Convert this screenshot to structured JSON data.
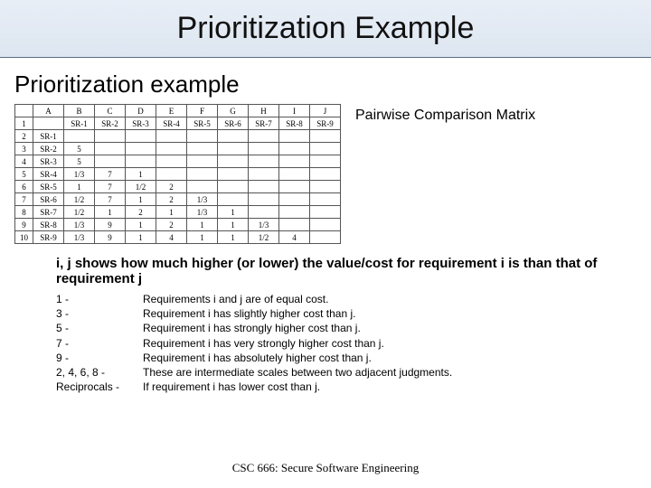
{
  "title": "Prioritization Example",
  "subtitle": "Prioritization example",
  "matrix_caption": "Pairwise Comparison Matrix",
  "columns": [
    "",
    "A",
    "B",
    "C",
    "D",
    "E",
    "F",
    "G",
    "H",
    "I",
    "J"
  ],
  "header_row": [
    "1",
    "",
    "SR-1",
    "SR-2",
    "SR-3",
    "SR-4",
    "SR-5",
    "SR-6",
    "SR-7",
    "SR-8",
    "SR-9"
  ],
  "rows": [
    [
      "2",
      "SR-1",
      "",
      "",
      "",
      "",
      "",
      "",
      "",
      "",
      ""
    ],
    [
      "3",
      "SR-2",
      "5",
      "",
      "",
      "",
      "",
      "",
      "",
      "",
      ""
    ],
    [
      "4",
      "SR-3",
      "5",
      "",
      "",
      "",
      "",
      "",
      "",
      "",
      ""
    ],
    [
      "5",
      "SR-4",
      "1/3",
      "7",
      "1",
      "",
      "",
      "",
      "",
      "",
      ""
    ],
    [
      "6",
      "SR-5",
      "1",
      "7",
      "1/2",
      "2",
      "",
      "",
      "",
      "",
      ""
    ],
    [
      "7",
      "SR-6",
      "1/2",
      "7",
      "1",
      "2",
      "1/3",
      "",
      "",
      "",
      ""
    ],
    [
      "8",
      "SR-7",
      "1/2",
      "1",
      "2",
      "1",
      "1/3",
      "1",
      "",
      "",
      ""
    ],
    [
      "9",
      "SR-8",
      "1/3",
      "9",
      "1",
      "2",
      "1",
      "1",
      "1/3",
      "",
      ""
    ],
    [
      "10",
      "SR-9",
      "1/3",
      "9",
      "1",
      "4",
      "1",
      "1",
      "1/2",
      "4",
      ""
    ]
  ],
  "explain": "i, j shows how much higher (or lower) the value/cost for requirement i is than that of requirement j",
  "legend": [
    {
      "key": "1 -",
      "text": "Requirements i and j are of equal cost."
    },
    {
      "key": "3 -",
      "text": "Requirement i has slightly higher cost than j."
    },
    {
      "key": "5 -",
      "text": "Requirement i has strongly higher cost than j."
    },
    {
      "key": "7 -",
      "text": "Requirement i has very strongly higher cost than j."
    },
    {
      "key": "9 -",
      "text": "Requirement i has absolutely higher cost than j."
    },
    {
      "key": "2, 4, 6, 8 -",
      "text": "These are intermediate scales between two adjacent judgments."
    },
    {
      "key": "Reciprocals -",
      "text": "If requirement i has lower cost than j."
    }
  ],
  "footer": "CSC 666: Secure Software Engineering",
  "chart_data": {
    "type": "table",
    "title": "Pairwise Comparison Matrix",
    "row_labels": [
      "SR-1",
      "SR-2",
      "SR-3",
      "SR-4",
      "SR-5",
      "SR-6",
      "SR-7",
      "SR-8",
      "SR-9"
    ],
    "col_labels": [
      "SR-1",
      "SR-2",
      "SR-3",
      "SR-4",
      "SR-5",
      "SR-6",
      "SR-7",
      "SR-8",
      "SR-9"
    ],
    "values": [
      [
        null,
        null,
        null,
        null,
        null,
        null,
        null,
        null,
        null
      ],
      [
        "5",
        null,
        null,
        null,
        null,
        null,
        null,
        null,
        null
      ],
      [
        "5",
        null,
        null,
        null,
        null,
        null,
        null,
        null,
        null
      ],
      [
        "1/3",
        "7",
        "1",
        null,
        null,
        null,
        null,
        null,
        null
      ],
      [
        "1",
        "7",
        "1/2",
        "2",
        null,
        null,
        null,
        null,
        null
      ],
      [
        "1/2",
        "7",
        "1",
        "2",
        "1/3",
        null,
        null,
        null,
        null
      ],
      [
        "1/2",
        "1",
        "2",
        "1",
        "1/3",
        "1",
        null,
        null,
        null
      ],
      [
        "1/3",
        "9",
        "1",
        "2",
        "1",
        "1",
        "1/3",
        null,
        null
      ],
      [
        "1/3",
        "9",
        "1",
        "4",
        "1",
        "1",
        "1/2",
        "4",
        null
      ]
    ]
  }
}
